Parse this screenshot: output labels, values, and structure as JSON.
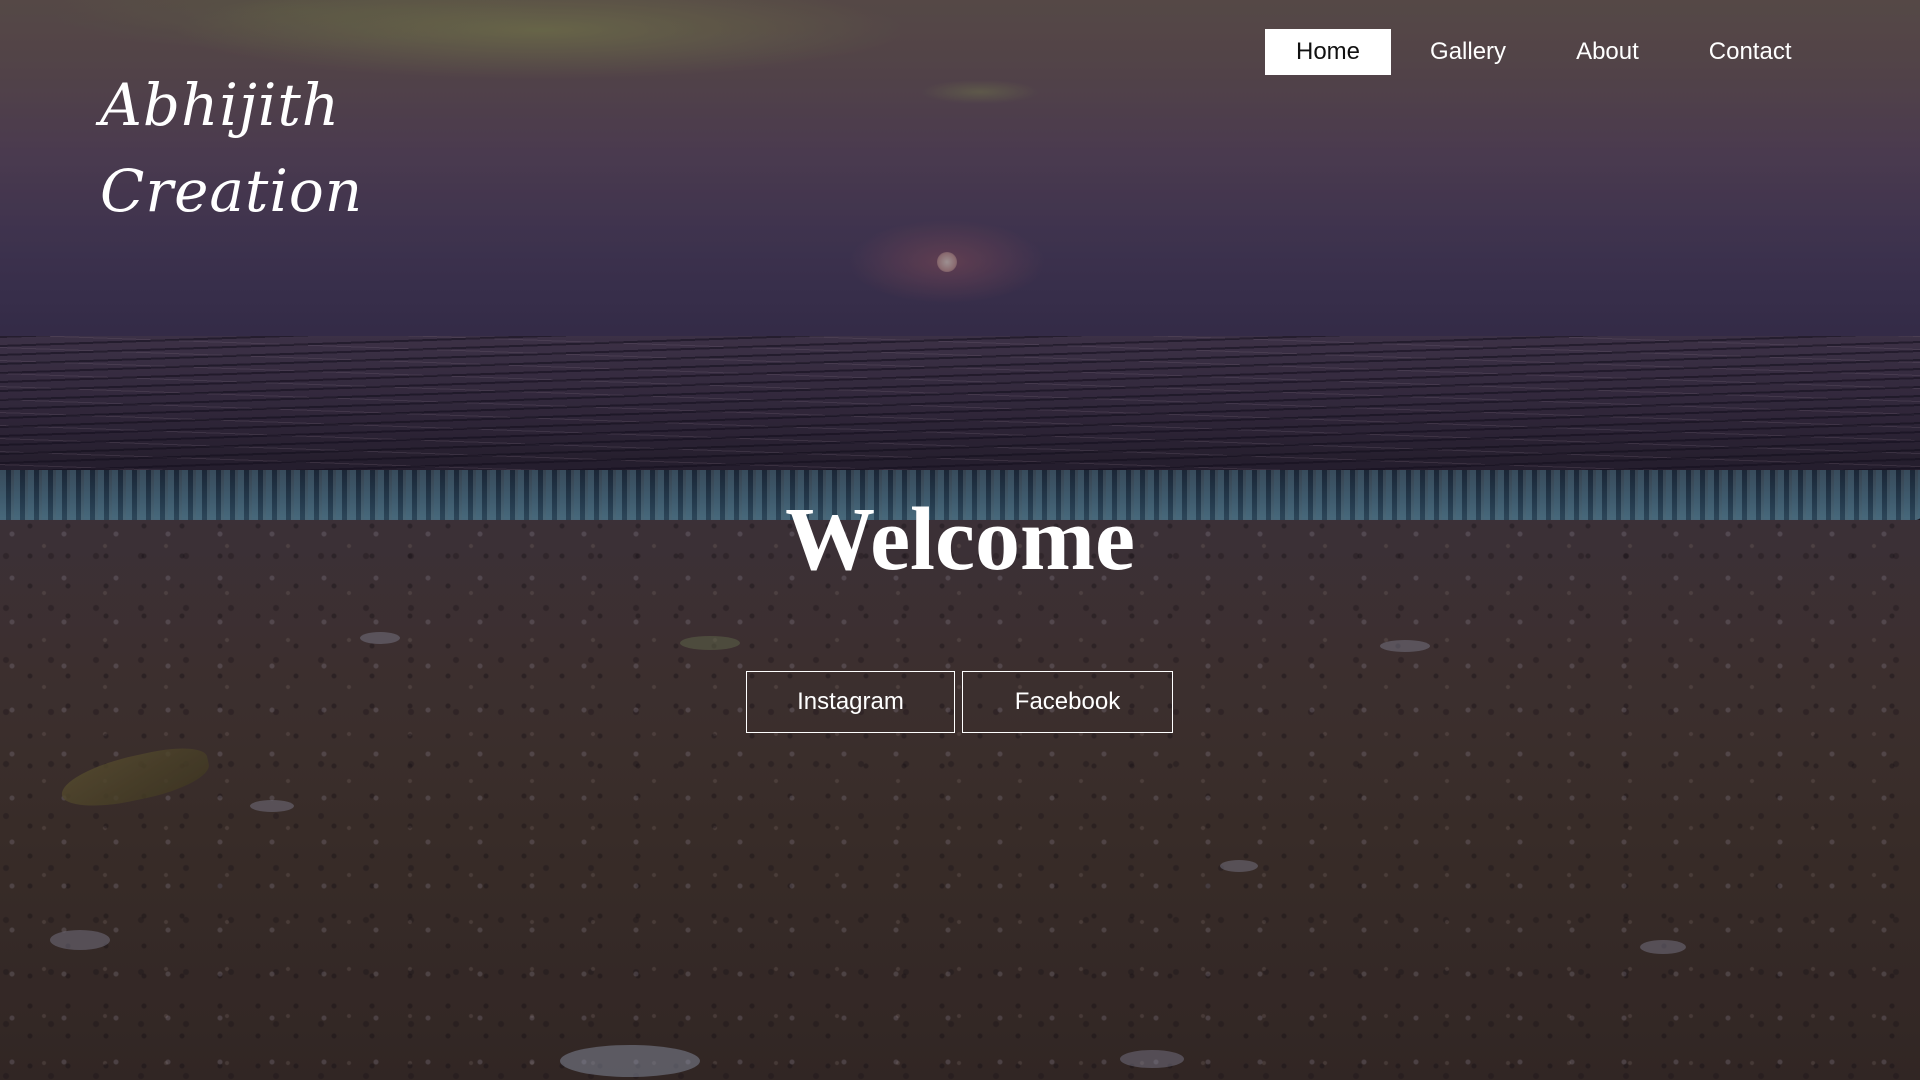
{
  "logo": {
    "line1": "Abhijith",
    "line2": "Creation"
  },
  "nav": {
    "items": [
      {
        "label": "Home",
        "active": true
      },
      {
        "label": "Gallery",
        "active": false
      },
      {
        "label": "About",
        "active": false
      },
      {
        "label": "Contact",
        "active": false
      }
    ]
  },
  "hero": {
    "heading": "Welcome",
    "buttons": {
      "instagram": "Instagram",
      "facebook": "Facebook"
    },
    "background": "sunset-beach-photo"
  },
  "colors": {
    "text": "#ffffff",
    "active_nav_bg": "#ffffff",
    "active_nav_text": "#111111"
  }
}
